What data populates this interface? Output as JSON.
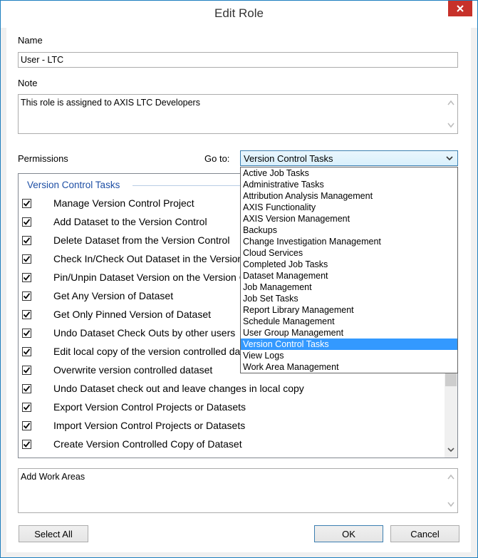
{
  "window": {
    "title": "Edit Role"
  },
  "name": {
    "label": "Name",
    "value": "User - LTC"
  },
  "note": {
    "label": "Note",
    "value": "This role is assigned to AXIS LTC Developers"
  },
  "permissions": {
    "label": "Permissions",
    "goto_label": "Go to:",
    "goto_selected": "Version Control Tasks",
    "dropdown_options": [
      "Active Job Tasks",
      "Administrative Tasks",
      "Attribution Analysis Management",
      "AXIS Functionality",
      "AXIS Version Management",
      "Backups",
      "Change Investigation Management",
      "Cloud Services",
      "Completed Job Tasks",
      "Dataset Management",
      "Job Management",
      "Job Set Tasks",
      "Report Library Management",
      "Schedule Management",
      "User Group Management",
      "Version Control Tasks",
      "View Logs",
      "Work Area Management"
    ],
    "group_title": "Version Control Tasks",
    "items": [
      "Manage Version Control Project",
      "Add Dataset to the Version Control",
      "Delete Dataset from the Version Control",
      "Check In/Check Out Dataset in the Version Control",
      "Pin/Unpin Dataset Version on the Version Control",
      "Get Any Version of Dataset",
      "Get Only Pinned Version of Dataset",
      "Undo Dataset Check Outs by other users",
      "Edit local copy of the version controlled dataset",
      "Overwrite version controlled dataset",
      "Undo Dataset check out and leave changes in local copy",
      "Export Version Control Projects or Datasets",
      "Import Version Control Projects or Datasets",
      "Create Version Controlled Copy of Dataset"
    ]
  },
  "description": {
    "value": "Add Work Areas"
  },
  "buttons": {
    "select_all": "Select All",
    "ok": "OK",
    "cancel": "Cancel"
  },
  "colors": {
    "close": "#c7312a",
    "selection": "#3399ff",
    "group_title": "#1e4fa5"
  }
}
